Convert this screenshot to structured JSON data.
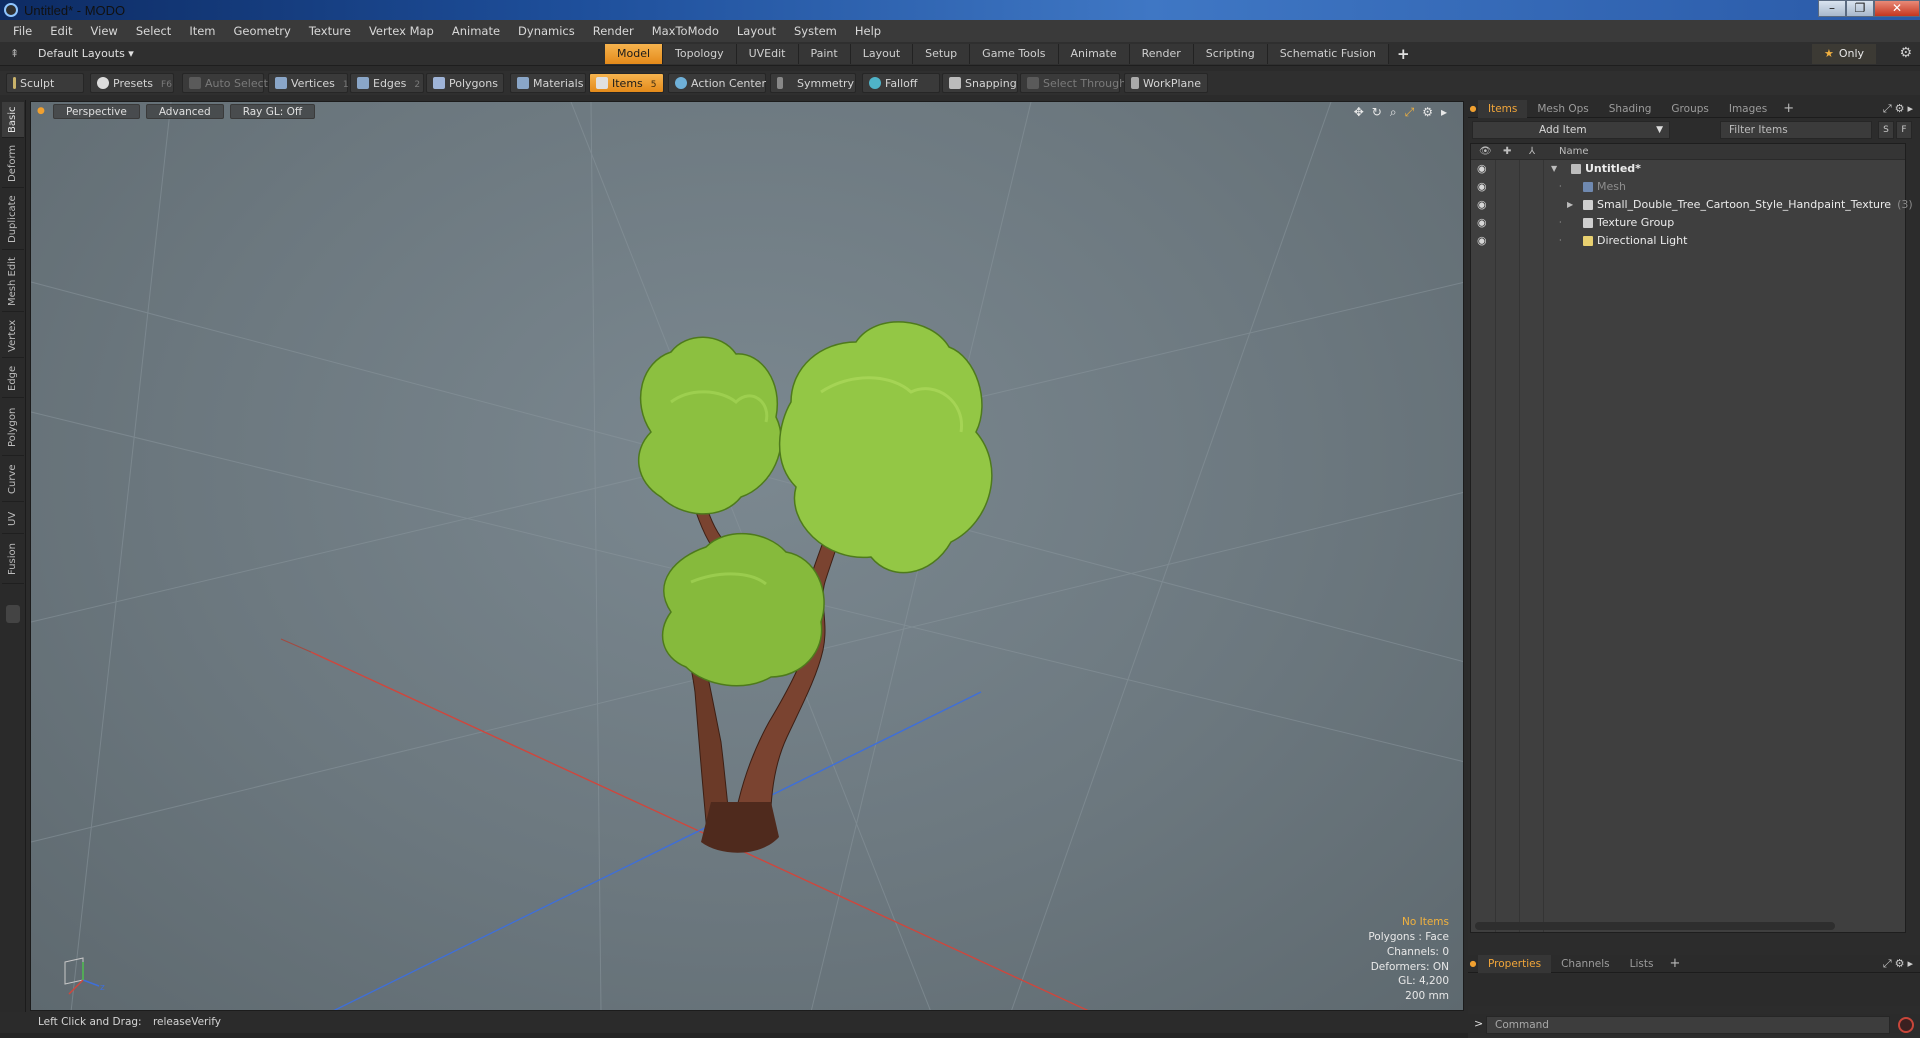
{
  "window": {
    "title": "Untitled* - MODO"
  },
  "menu": [
    "File",
    "Edit",
    "View",
    "Select",
    "Item",
    "Geometry",
    "Texture",
    "Vertex Map",
    "Animate",
    "Dynamics",
    "Render",
    "MaxToModo",
    "Layout",
    "System",
    "Help"
  ],
  "layoutbar": {
    "layouts_label": "Default Layouts ▾",
    "tabs": [
      "Model",
      "Topology",
      "UVEdit",
      "Paint",
      "Layout",
      "Setup",
      "Game Tools",
      "Animate",
      "Render",
      "Scripting",
      "Schematic Fusion"
    ],
    "active_tab": "Model",
    "only_label": "Only"
  },
  "toolbar": {
    "sculpt": "Sculpt",
    "presets": "Presets",
    "presets_key": "F6",
    "auto_select": "Auto Select",
    "vertices": "Vertices",
    "vertices_key": "1",
    "edges": "Edges",
    "edges_key": "2",
    "polygons": "Polygons",
    "materials": "Materials",
    "items": "Items",
    "items_key": "5",
    "action_center": "Action Center",
    "symmetry": "Symmetry",
    "falloff": "Falloff",
    "snapping": "Snapping",
    "select_through": "Select Through",
    "workplane": "WorkPlane"
  },
  "left_tabs": [
    "Basic",
    "Deform",
    "Duplicate",
    "Mesh Edit",
    "Vertex",
    "Edge",
    "Polygon",
    "Curve",
    "UV",
    "Fusion"
  ],
  "viewport": {
    "perspective": "Perspective",
    "advanced": "Advanced",
    "raygl": "Ray GL: Off",
    "hud": {
      "no_items": "No Items",
      "polygons": "Polygons : Face",
      "channels": "Channels: 0",
      "deformers": "Deformers: ON",
      "gl": "GL: 4,200",
      "size": "200 mm"
    },
    "colors": {
      "foliage": "#7fb038",
      "trunk": "#6b3a28",
      "x_axis": "#d0463c",
      "z_axis": "#3f6fd8"
    }
  },
  "status": {
    "label": "Left Click and Drag:",
    "value": "releaseVerify"
  },
  "items_panel": {
    "tabs": [
      "Items",
      "Mesh Ops",
      "Shading",
      "Groups",
      "Images"
    ],
    "active_tab": "Items",
    "add_item": "Add Item",
    "filter_placeholder": "Filter Items",
    "s_btn": "S",
    "f_btn": "F",
    "name_header": "Name",
    "rows": [
      {
        "label": "Untitled*",
        "count": ""
      },
      {
        "label": "Mesh",
        "count": ""
      },
      {
        "label": "Small_Double_Tree_Cartoon_Style_Handpaint_Texture",
        "count": "(3)"
      },
      {
        "label": "Texture Group",
        "count": ""
      },
      {
        "label": "Directional Light",
        "count": ""
      }
    ]
  },
  "props_panel": {
    "tabs": [
      "Properties",
      "Channels",
      "Lists"
    ],
    "active_tab": "Properties"
  },
  "command": {
    "placeholder": "Command"
  }
}
